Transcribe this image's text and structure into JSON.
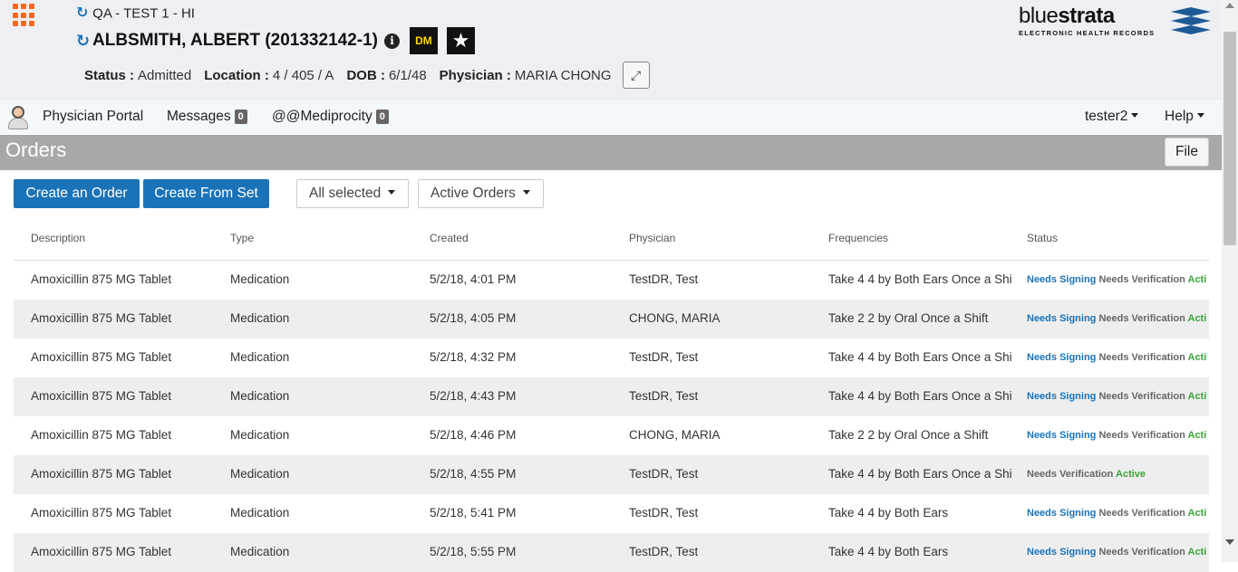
{
  "header": {
    "census": "QA - TEST 1 - HI",
    "patient_name": "ALBSMITH, ALBERT (201332142-1)",
    "badge_dm": "DM",
    "badge_star_num": "1",
    "status_label": "Status :",
    "status_value": "Admitted",
    "location_label": "Location :",
    "location_value": "4 / 405 / A",
    "dob_label": "DOB :",
    "dob_value": "6/1/48",
    "physician_label": "Physician :",
    "physician_value": "MARIA CHONG"
  },
  "brand": {
    "word_light": "blue",
    "word_bold": "strata",
    "tagline": "ELECTRONIC HEALTH RECORDS",
    "color": "#1e5a96"
  },
  "nav": {
    "physician_portal": "Physician Portal",
    "messages": "Messages",
    "messages_count": "0",
    "mediprocity": "@@Mediprocity",
    "mediprocity_count": "0",
    "user": "tester2",
    "help": "Help"
  },
  "page": {
    "title": "Orders",
    "file_button": "File"
  },
  "toolbar": {
    "create_order": "Create an Order",
    "create_from_set": "Create From Set",
    "filter_selected": "All selected",
    "filter_status": "Active Orders"
  },
  "table": {
    "columns": [
      "Description",
      "Type",
      "Created",
      "Physician",
      "Frequencies",
      "Status"
    ],
    "rows": [
      {
        "description": "Amoxicillin 875 MG Tablet",
        "type": "Medication",
        "created": "5/2/18, 4:01 PM",
        "physician": "TestDR, Test",
        "frequency": "Take 4 4 by Both Ears Once a Shi",
        "needs_signing": "Needs Signing",
        "needs_verification": "Needs Verification",
        "active": "Acti"
      },
      {
        "description": "Amoxicillin 875 MG Tablet",
        "type": "Medication",
        "created": "5/2/18, 4:05 PM",
        "physician": "CHONG, MARIA",
        "frequency": "Take 2 2 by Oral Once a Shift",
        "needs_signing": "Needs Signing",
        "needs_verification": "Needs Verification",
        "active": "Acti"
      },
      {
        "description": "Amoxicillin 875 MG Tablet",
        "type": "Medication",
        "created": "5/2/18, 4:32 PM",
        "physician": "TestDR, Test",
        "frequency": "Take 4 4 by Both Ears Once a Shi",
        "needs_signing": "Needs Signing",
        "needs_verification": "Needs Verification",
        "active": "Acti"
      },
      {
        "description": "Amoxicillin 875 MG Tablet",
        "type": "Medication",
        "created": "5/2/18, 4:43 PM",
        "physician": "TestDR, Test",
        "frequency": "Take 4 4 by Both Ears Once a Shi",
        "needs_signing": "Needs Signing",
        "needs_verification": "Needs Verification",
        "active": "Acti"
      },
      {
        "description": "Amoxicillin 875 MG Tablet",
        "type": "Medication",
        "created": "5/2/18, 4:46 PM",
        "physician": "CHONG, MARIA",
        "frequency": "Take 2 2 by Oral Once a Shift",
        "needs_signing": "Needs Signing",
        "needs_verification": "Needs Verification",
        "active": "Acti"
      },
      {
        "description": "Amoxicillin 875 MG Tablet",
        "type": "Medication",
        "created": "5/2/18, 4:55 PM",
        "physician": "TestDR, Test",
        "frequency": "Take 4 4 by Both Ears Once a Shi",
        "needs_signing": "",
        "needs_verification": "Needs Verification",
        "active": "Active"
      },
      {
        "description": "Amoxicillin 875 MG Tablet",
        "type": "Medication",
        "created": "5/2/18, 5:41 PM",
        "physician": "TestDR, Test",
        "frequency": "Take 4 4 by Both Ears",
        "needs_signing": "Needs Signing",
        "needs_verification": "Needs Verification",
        "active": "Acti"
      },
      {
        "description": "Amoxicillin 875 MG Tablet",
        "type": "Medication",
        "created": "5/2/18, 5:55 PM",
        "physician": "TestDR, Test",
        "frequency": "Take 4 4 by Both Ears",
        "needs_signing": "Needs Signing",
        "needs_verification": "Needs Verification",
        "active": "Acti"
      }
    ]
  },
  "colors": {
    "accent": "#1a73b8",
    "apps_icon": "#f26a21",
    "active_status": "#3aa53a",
    "title_bar": "#a8a8a8"
  }
}
